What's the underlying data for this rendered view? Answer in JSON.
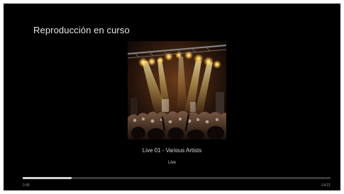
{
  "header": {
    "title": "Reproducción en curso"
  },
  "now_playing": {
    "artwork_icon": "concert-stage-lights-image",
    "track_title": "Live 01 - Various Artists",
    "subtitle": "Live"
  },
  "playback": {
    "elapsed": "2:45",
    "remaining": "-14:21",
    "progress_fraction": 0.16
  },
  "colors": {
    "background": "#000000",
    "progress_fill": "#d4d4d4",
    "progress_track": "#3a3a3a"
  }
}
